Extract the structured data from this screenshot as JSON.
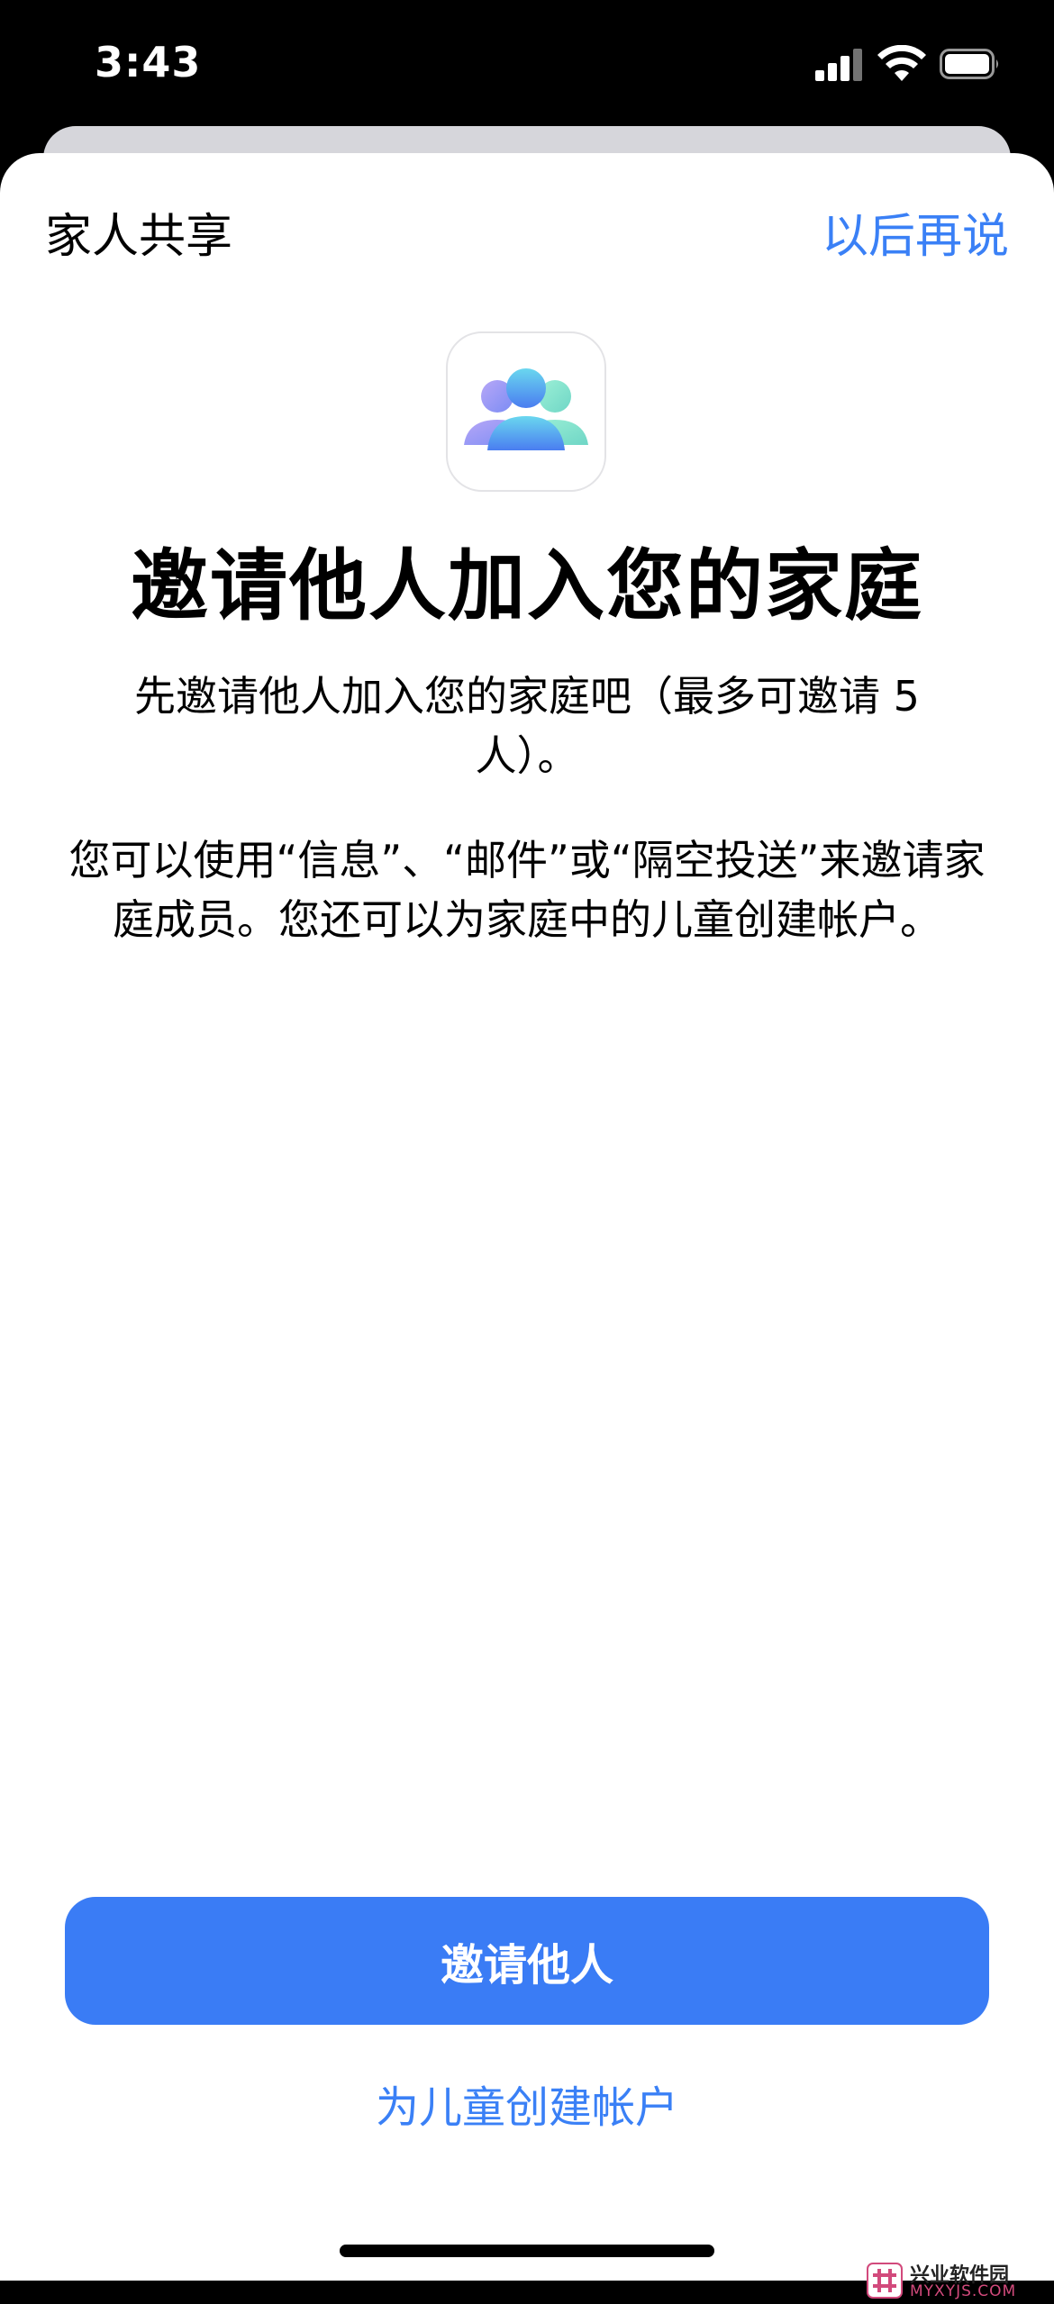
{
  "status_bar": {
    "time": "3:43"
  },
  "nav": {
    "title": "家人共享",
    "later_button": "以后再说"
  },
  "main": {
    "headline": "邀请他人加入您的家庭",
    "subtitle": "先邀请他人加入您的家庭吧（最多可邀请 5 人）。",
    "description": "您可以使用“信息”、“邮件”或“隔空投送”来邀请家庭成员。您还可以为家庭中的儿童创建帐户。"
  },
  "actions": {
    "primary_button": "邀请他人",
    "secondary_link": "为儿童创建帐户"
  },
  "watermark": {
    "line1": "兴业软件园",
    "line2": "MYXYJS.COM"
  },
  "colors": {
    "accent": "#3a7cf5",
    "link": "#3a80f6"
  },
  "icons": [
    "signal-icon",
    "wifi-icon",
    "battery-icon",
    "family-sharing-icon",
    "home-indicator"
  ]
}
